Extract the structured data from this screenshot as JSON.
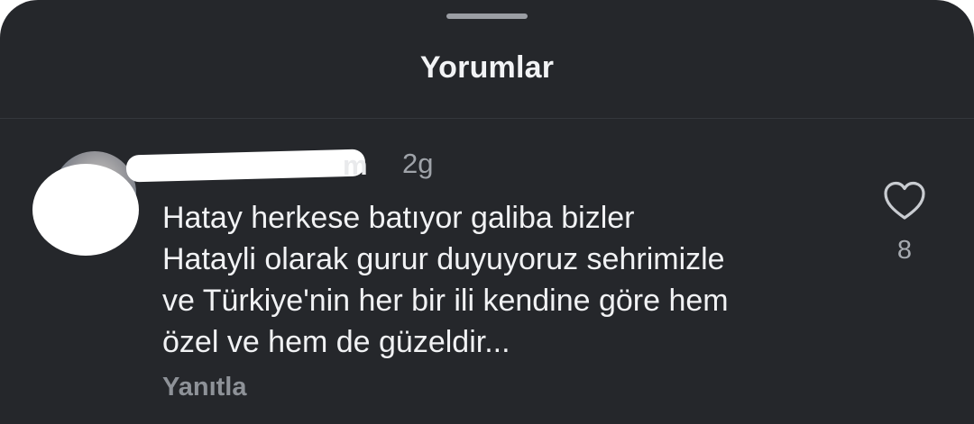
{
  "sheet": {
    "title": "Yorumlar"
  },
  "comment": {
    "username_visible_fragment": "m",
    "timestamp": "2g",
    "text_lines": [
      "Hatay herkese batıyor galiba bizler",
      "Hatayli olarak gurur duyuyoruz sehrimizle",
      "ve Türkiye'nin her bir ili kendine göre hem",
      "özel ve hem de güzeldir..."
    ],
    "reply_label": "Yanıtla",
    "like_count": "8"
  },
  "icons": {
    "like": "heart-outline-icon"
  },
  "colors": {
    "background": "#25272b",
    "text_primary": "#f1f2f4",
    "text_secondary": "#9fa3a9"
  }
}
